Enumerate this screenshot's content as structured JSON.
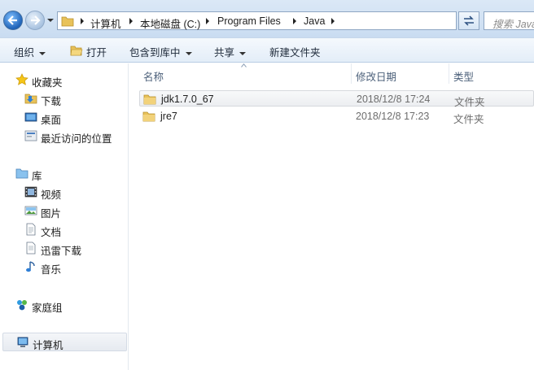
{
  "address": {
    "crumbs": [
      "计算机",
      "本地磁盘 (C:)",
      "Program Files",
      "Java"
    ],
    "search_placeholder": "搜索 Java"
  },
  "toolbar": {
    "organize": "组织",
    "open": "打开",
    "include_in_library": "包含到库中",
    "share": "共享",
    "new_folder": "新建文件夹"
  },
  "nav": {
    "favorites": "收藏夹",
    "downloads": "下载",
    "desktop": "桌面",
    "recent": "最近访问的位置",
    "libraries": "库",
    "videos": "视频",
    "pictures": "图片",
    "documents": "文档",
    "xunlei": "迅雷下载",
    "music": "音乐",
    "homegroup": "家庭组",
    "computer": "计算机"
  },
  "columns": {
    "name": "名称",
    "modified": "修改日期",
    "type": "类型"
  },
  "files": [
    {
      "name": "jdk1.7.0_67",
      "modified": "2018/12/8 17:24",
      "type": "文件夹"
    },
    {
      "name": "jre7",
      "modified": "2018/12/8 17:23",
      "type": "文件夹"
    }
  ],
  "colors": {
    "accent": "#3f6da0",
    "folder": "#e8c25a"
  }
}
